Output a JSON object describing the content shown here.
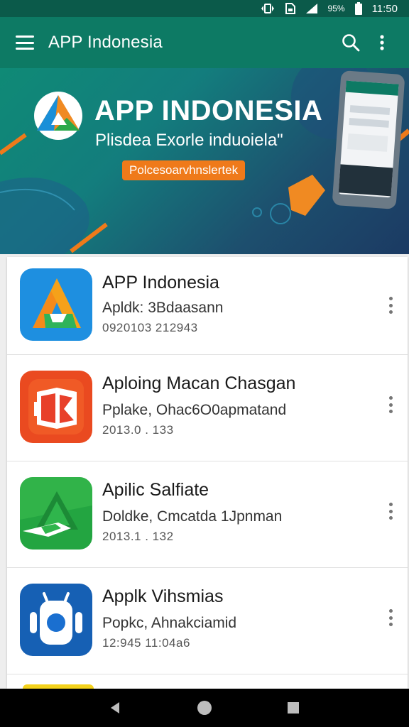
{
  "status_bar": {
    "battery_percent": "95%",
    "time": "11:50"
  },
  "app_bar": {
    "title": "APP Indonesia",
    "menu_icon": "hamburger-menu-icon",
    "search_icon": "search-icon",
    "more_icon": "more-vert-icon",
    "background": "#0d7a64"
  },
  "banner": {
    "headline": "APP INDONESIA",
    "subline": "Plisdea Exorle induoiela\"",
    "pill_label": "Polcesoarvhnslertek",
    "accent": "#ef7a1a"
  },
  "apps": [
    {
      "name": "APP Indonesia",
      "subtitle": "Apldk: 3Bdaasann",
      "meta": "0920103 212943",
      "icon": "app-indonesia-logo-icon"
    },
    {
      "name": "Aploing Macan Chasgan",
      "subtitle": "Pplake, Ohac6O0apmatand",
      "meta": "2013.0 . 133",
      "icon": "red-book-logo-icon"
    },
    {
      "name": "Apilic Salfiate",
      "subtitle": "Doldke, Cmcatda 1Jpnman",
      "meta": "2013.1 . 132",
      "icon": "green-triangle-logo-icon"
    },
    {
      "name": "Applk Vihsmias",
      "subtitle": "Popkc, Ahnakciamid",
      "meta": "12:945 11:04a6",
      "icon": "android-robot-icon"
    }
  ],
  "nav_bar": {
    "back_icon": "back-triangle-icon",
    "home_icon": "home-circle-icon",
    "recents_icon": "recents-square-icon"
  }
}
